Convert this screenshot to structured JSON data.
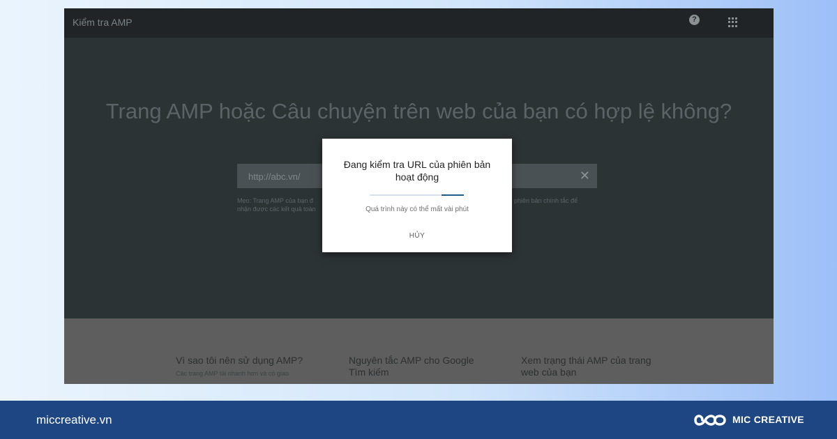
{
  "app": {
    "title": "Kiểm tra AMP",
    "help_icon": "help-icon",
    "apps_icon": "apps-grid-icon"
  },
  "hero": {
    "heading": "Trang AMP hoặc Câu chuyện trên web của bạn có hợp lệ không?"
  },
  "url_input": {
    "value": "http://abc.vn/",
    "clear_icon": "close-icon"
  },
  "tip": {
    "left": "Mẹo: Trang AMP của bạn đ nhận được các kết quả toàn",
    "right": "phiên bản chính tắc để"
  },
  "dialog": {
    "title": "Đang kiểm tra URL của phiên bản hoạt động",
    "subtitle": "Quá trình này có thể mất vài phút",
    "cancel_label": "HỦY"
  },
  "features": [
    {
      "title": "Vì sao tôi nên sử dụng AMP?",
      "desc": "Các trang AMP tải nhanh hơn và có giao"
    },
    {
      "title": "Nguyên tắc AMP cho Google Tìm kiếm",
      "desc": ""
    },
    {
      "title": "Xem trạng thái AMP của trang web của bạn",
      "desc": ""
    }
  ],
  "footer": {
    "site": "miccreative.vn",
    "brand": "MIC CREATIVE",
    "logo_icon": "infinity-logo-icon"
  },
  "colors": {
    "screen_bg": "#2c3335",
    "topbar_bg": "#202426",
    "dialog_bg": "#ffffff",
    "progress_accent": "#1f5a8c",
    "footer_bg": "#1e4683"
  }
}
